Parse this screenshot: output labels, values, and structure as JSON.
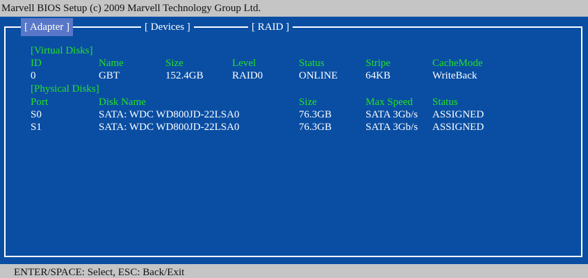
{
  "window": {
    "title": "Marvell BIOS Setup (c) 2009 Marvell Technology Group Ltd."
  },
  "tabs": [
    {
      "label": "[ Adapter ]"
    },
    {
      "label": "[ Devices ]"
    },
    {
      "label": "[  RAID  ]"
    }
  ],
  "virtual_disks": {
    "section_label": "[Virtual Disks]",
    "headers": [
      "ID",
      "Name",
      "Size",
      "Level",
      "Status",
      "Stripe",
      "CacheMode"
    ],
    "rows": [
      [
        "0",
        "GBT",
        "152.4GB",
        "RAID0",
        "ONLINE",
        "64KB",
        "WriteBack"
      ]
    ]
  },
  "physical_disks": {
    "section_label": "[Physical Disks]",
    "headers": [
      "Port",
      "Disk Name",
      "Size",
      "Max Speed",
      "Status"
    ],
    "rows": [
      [
        "S0",
        "SATA: WDC WD800JD-22LSA0",
        "76.3GB",
        "SATA 3Gb/s",
        "ASSIGNED"
      ],
      [
        "S1",
        "SATA: WDC WD800JD-22LSA0",
        "76.3GB",
        "SATA 3Gb/s",
        "ASSIGNED"
      ]
    ]
  },
  "statusbar": {
    "text": "ENTER/SPACE: Select, ESC: Back/Exit"
  },
  "colors": {
    "background": "#0a4ea3",
    "label_green": "#24e024",
    "text_white": "#ffffff",
    "tab_active": "#5877c8",
    "bar_gray": "#c5c5c5"
  }
}
